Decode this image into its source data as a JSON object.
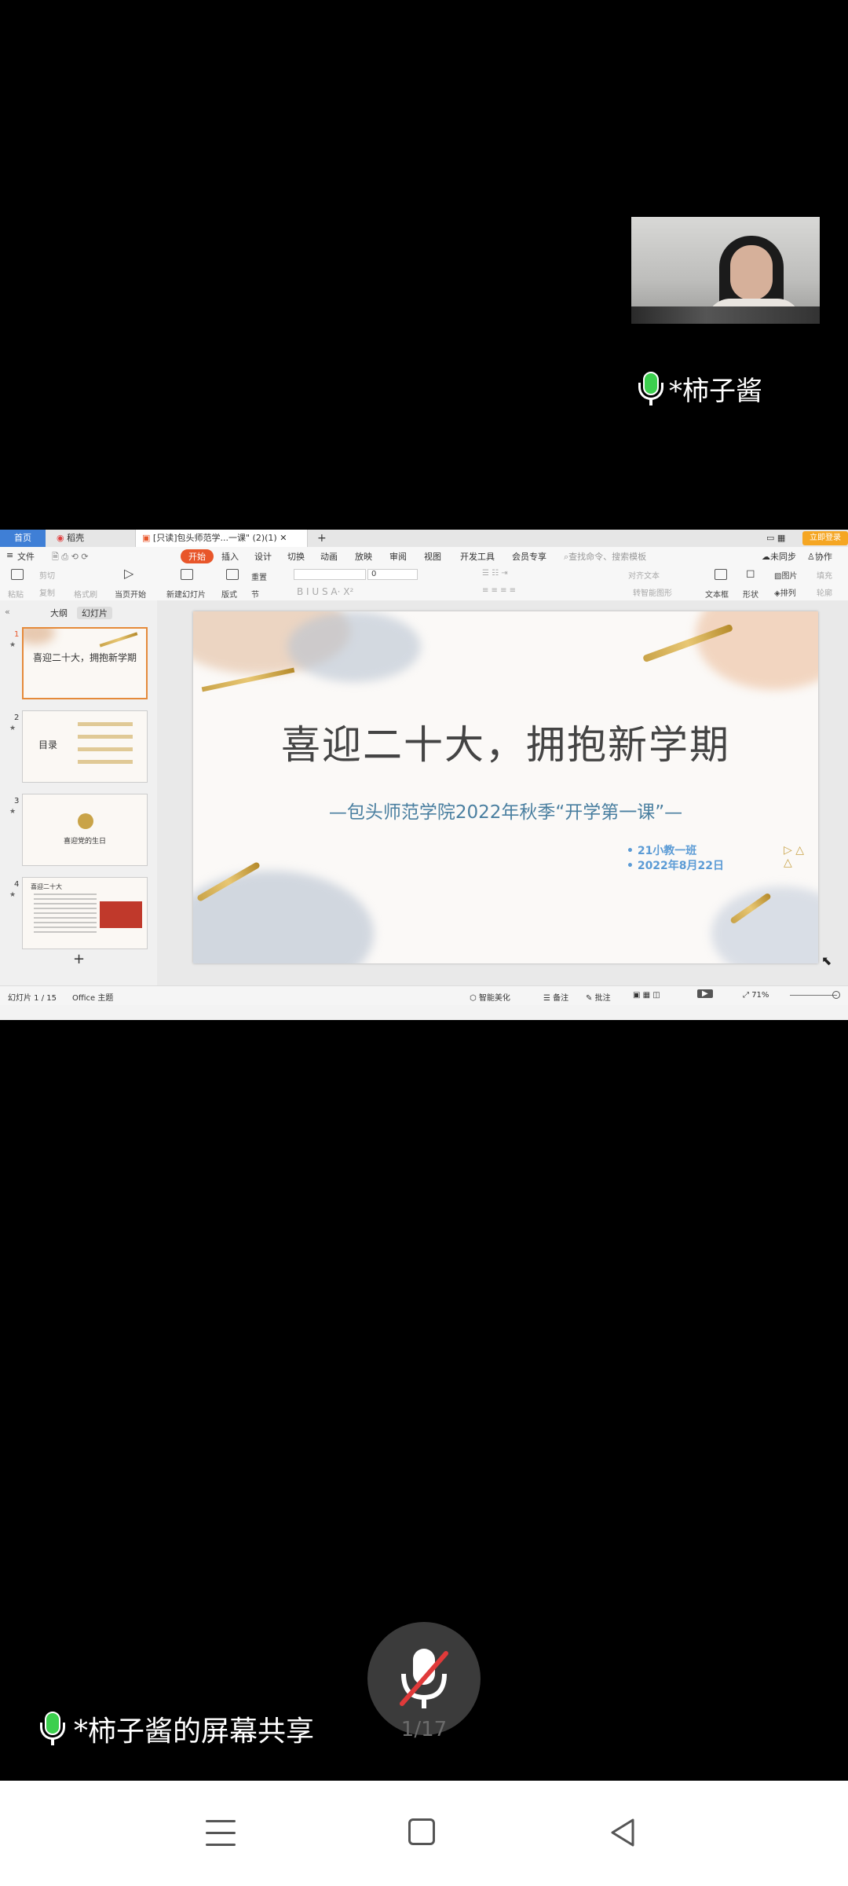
{
  "participant": {
    "name": "*柿子酱"
  },
  "screen_share": {
    "tabs": {
      "home": "首页",
      "draft": "稻壳",
      "doc": "[只读]包头师范学...一课\" (2)(1)",
      "add": "+"
    },
    "login": "立即登录",
    "menu": {
      "file": "文件",
      "start": "开始",
      "insert": "插入",
      "design": "设计",
      "switch": "切换",
      "animate": "动画",
      "play": "放映",
      "review": "审阅",
      "view": "视图",
      "dev": "开发工具",
      "vip": "会员专享",
      "search": "查找命令、搜索模板",
      "sync": "未同步",
      "collab": "协作"
    },
    "ribbon": {
      "paste": "粘贴",
      "cut": "剪切",
      "copy": "复制",
      "format_painter": "格式刷",
      "from_start": "当页开始",
      "new_slide": "新建幻灯片",
      "layout": "版式",
      "reset": "重置",
      "section": "节",
      "font_size": "0",
      "align_text": "对齐文本",
      "smart_shape": "转智能图形",
      "textbox": "文本框",
      "shape": "形状",
      "picture": "图片",
      "arrange": "排列",
      "fill": "填充",
      "outline": "轮廓"
    },
    "pane": {
      "outline_tab": "大纲",
      "slides_tab": "幻灯片",
      "add": "+"
    },
    "thumbnails": [
      {
        "num": "1",
        "title": "喜迎二十大，拥抱新学期"
      },
      {
        "num": "2",
        "title": "目录"
      },
      {
        "num": "3",
        "title": "喜迎党的生日"
      },
      {
        "num": "4",
        "title": "喜迎二十大"
      }
    ],
    "slide": {
      "title": "喜迎二十大，拥抱新学期",
      "subtitle": "—包头师范学院2022年秋季“开学第一课”—",
      "bullets": [
        "21小教一班",
        "2022年8月22日"
      ]
    },
    "status": {
      "slide_pos": "幻灯片 1 / 15",
      "theme": "Office 主题",
      "beautify": "智能美化",
      "notes": "备注",
      "comment": "批注",
      "zoom": "71%"
    }
  },
  "overlay": {
    "sharer": "*柿子酱的屏幕共享",
    "page": "1/17"
  },
  "colors": {
    "accent": "#e8562a",
    "mic_active": "#3ccf4e",
    "mute_slash": "#e03a3a"
  }
}
